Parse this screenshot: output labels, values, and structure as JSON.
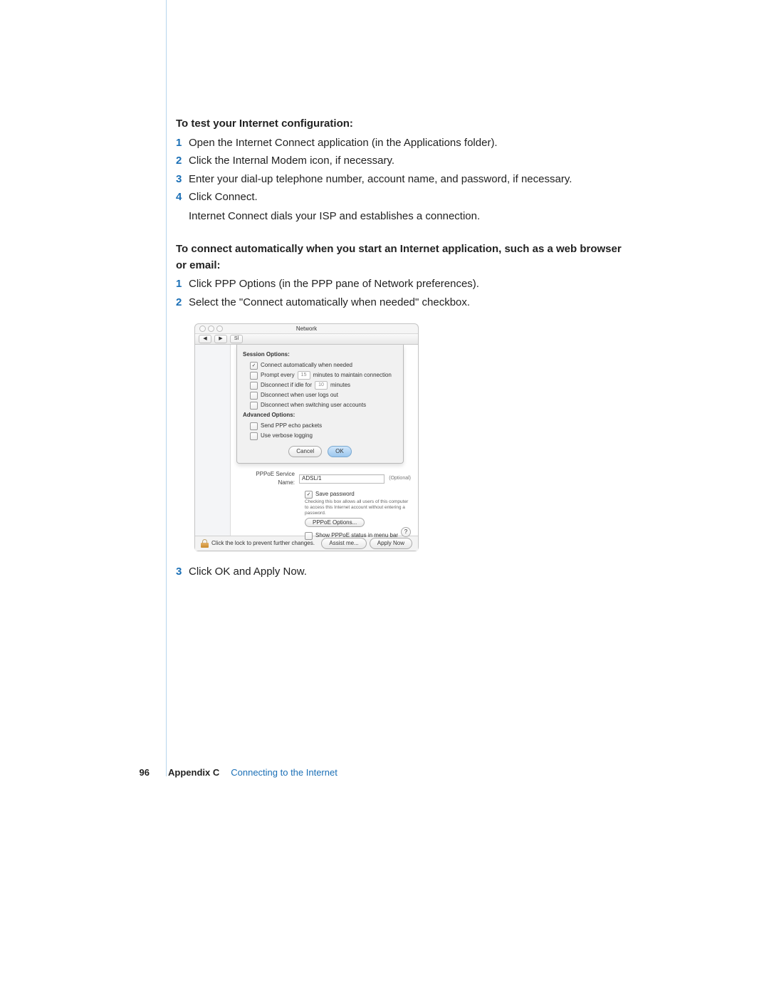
{
  "section1": {
    "heading": "To test your Internet configuration:",
    "steps": [
      "Open the Internet Connect application (in the Applications folder).",
      "Click the Internal Modem icon, if necessary.",
      "Enter your dial-up telephone number, account name, and password, if necessary.",
      "Click Connect."
    ],
    "after": "Internet Connect dials your ISP and establishes a connection."
  },
  "section2": {
    "heading": "To connect automatically when you start an Internet application, such as a web browser or email:",
    "steps": [
      "Click PPP Options (in the PPP pane of Network preferences).",
      "Select the \"Connect automatically when needed\" checkbox."
    ],
    "step3": "Click OK and Apply Now."
  },
  "dialog": {
    "title": "Network",
    "toolbar_btn": "Sl",
    "session_header": "Session Options:",
    "opt_connect_auto": "Connect automatically when needed",
    "opt_prompt_pre": "Prompt every",
    "opt_prompt_val": "15",
    "opt_prompt_post": "minutes to maintain connection",
    "opt_idle_pre": "Disconnect if idle for",
    "opt_idle_val": "10",
    "opt_idle_post": "minutes",
    "opt_logout": "Disconnect when user logs out",
    "opt_switch": "Disconnect when switching user accounts",
    "adv_header": "Advanced Options:",
    "opt_echo": "Send PPP echo packets",
    "opt_verbose": "Use verbose logging",
    "btn_cancel": "Cancel",
    "btn_ok": "OK",
    "svc_label": "PPPoE Service Name:",
    "svc_value": "ADSL/1",
    "svc_optional": "(Optional)",
    "save_pw": "Save password",
    "save_hint": "Checking this box allows all users of this computer to access this Internet account without entering a password.",
    "pppoe_options": "PPPoE Options...",
    "show_status": "Show PPPoE status in menu bar",
    "help": "?",
    "lock_text": "Click the lock to prevent further changes.",
    "assist": "Assist me...",
    "apply_now": "Apply Now"
  },
  "footer": {
    "page": "96",
    "appendix": "Appendix C",
    "chapter": "Connecting to the Internet"
  },
  "nums": [
    "1",
    "2",
    "3",
    "4"
  ]
}
